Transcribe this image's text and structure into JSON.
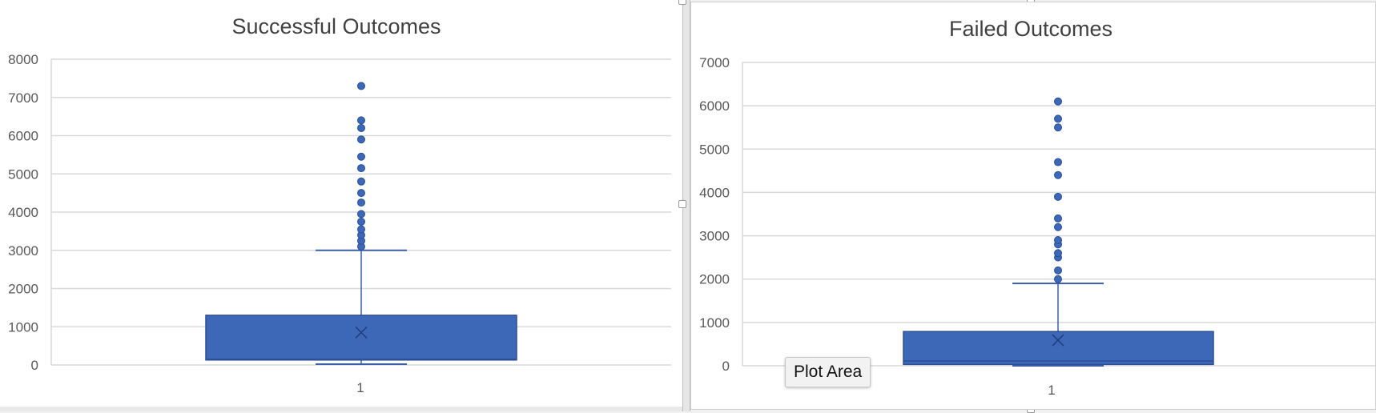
{
  "colors": {
    "box_fill": "#3d68b8",
    "box_stroke": "#2b4f96",
    "whisker": "#3a5ea8",
    "gridline": "#d9d9d9",
    "axis_text": "#595959",
    "title_text": "#404040"
  },
  "tooltip": {
    "text": "Plot Area"
  },
  "chart_data": [
    {
      "type": "box",
      "title": "Successful Outcomes",
      "categories": [
        "1"
      ],
      "ylim": [
        0,
        8000
      ],
      "yticks": [
        0,
        1000,
        2000,
        3000,
        4000,
        5000,
        6000,
        7000,
        8000
      ],
      "grid": true,
      "box": {
        "min": 20,
        "q1": 130,
        "median": 150,
        "q3": 1300,
        "max": 3000,
        "mean": 850
      },
      "outliers": [
        3100,
        3250,
        3400,
        3550,
        3750,
        3950,
        4250,
        4500,
        4800,
        5150,
        5450,
        5900,
        6200,
        6400,
        7300
      ]
    },
    {
      "type": "box",
      "title": "Failed Outcomes",
      "categories": [
        "1"
      ],
      "ylim": [
        0,
        7000
      ],
      "yticks": [
        0,
        1000,
        2000,
        3000,
        4000,
        5000,
        6000,
        7000
      ],
      "grid": true,
      "box": {
        "min": 0,
        "q1": 30,
        "median": 110,
        "q3": 790,
        "max": 1900,
        "mean": 590
      },
      "outliers": [
        2000,
        2200,
        2500,
        2600,
        2800,
        2900,
        3200,
        3400,
        3900,
        4400,
        4700,
        5500,
        5700,
        6100
      ]
    }
  ]
}
